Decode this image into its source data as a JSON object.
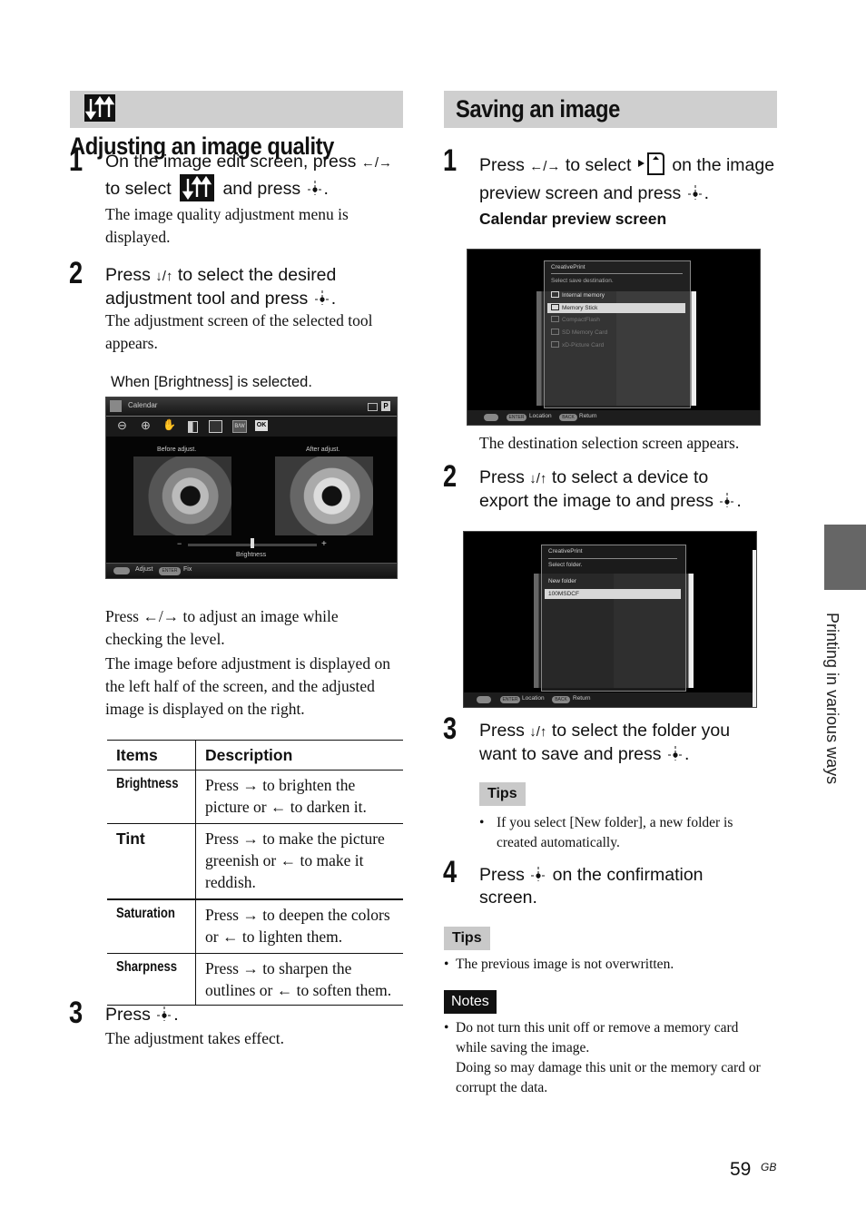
{
  "page": {
    "side_tab_label": "Printing in various ways",
    "page_number": "59",
    "page_suffix": "GB"
  },
  "left": {
    "header": {
      "icon": "image-quality-icon",
      "title": "Adjusting an image quality"
    },
    "steps": [
      {
        "num": "1",
        "instr_a": "On the image edit screen, press ",
        "instr_arrows": "←/→",
        "instr_b": "to select ",
        "instr_c": " and press ",
        "instr_end": ".",
        "desc": "The image quality adjustment menu is displayed."
      },
      {
        "num": "2",
        "instr_a": "Press ",
        "instr_arrows": "↓/↑",
        "instr_b": " to select the desired",
        "instr_c": "adjustment tool and press ",
        "instr_end": ".",
        "desc": "The adjustment screen of the selected tool appears.",
        "caption": "When [Brightness] is selected."
      },
      {
        "num": "3",
        "instr_a": "Press ",
        "instr_end": ".",
        "desc": "The adjustment takes effect."
      }
    ],
    "screen": {
      "title": "Calendar",
      "toolbar": [
        "zoom-out-icon",
        "zoom-in-icon",
        "hand-icon",
        "rotate-icon",
        "quality-icon",
        "bw-icon",
        "ok-icon"
      ],
      "bw_label": "B/W",
      "ok_label": "OK",
      "before_label": "Before adjust.",
      "after_label": "After adjust.",
      "slider_label": "Brightness",
      "slider_minus": "−",
      "slider_plus": "+",
      "slider_value_fraction": 0.5,
      "footer_adjust": "Adjust",
      "footer_enter": "ENTER",
      "footer_fix": "Fix"
    },
    "after_screen_p1": "Press ←/→ to adjust an image while checking the level.",
    "after_screen_p2": "The image before adjustment is displayed on the left half of the screen, and the adjusted image is displayed on the right.",
    "table": {
      "headers": [
        "Items",
        "Description"
      ],
      "rows": [
        {
          "item": "Brightness",
          "desc": "Press → to brighten the picture or ← to darken it."
        },
        {
          "item": "Tint",
          "desc": "Press → to make the picture greenish or ← to make it reddish."
        },
        {
          "item": "Saturation",
          "desc": "Press → to deepen the colors or ← to lighten them."
        },
        {
          "item": "Sharpness",
          "desc": "Press → to sharpen the outlines or ← to soften them."
        }
      ]
    }
  },
  "right": {
    "header": {
      "title": "Saving an image"
    },
    "steps": [
      {
        "num": "1",
        "instr_a": "Press ",
        "instr_arrows": "←/→",
        "instr_b": " to select ",
        "instr_c": " on the image",
        "instr_d": "preview screen and press ",
        "instr_end": ".",
        "subheading": "Calendar preview screen",
        "desc": "The destination selection screen appears."
      },
      {
        "num": "2",
        "instr_a": "Press ",
        "instr_arrows": "↓/↑",
        "instr_b": " to select a device to",
        "instr_c": "export the image to and press ",
        "instr_end": "."
      },
      {
        "num": "3",
        "instr_a": "Press ",
        "instr_arrows": "↓/↑",
        "instr_b": " to select the folder you",
        "instr_c": "want to save and press ",
        "instr_end": ".",
        "tips_label": "Tips",
        "tip": "If you select [New folder], a new folder is created automatically."
      },
      {
        "num": "4",
        "instr_a": "Press ",
        "instr_b": " on the confirmation",
        "instr_c": "screen."
      }
    ],
    "screen1": {
      "dialog_title": "CreativePrint",
      "prompt": "Select save destination.",
      "options": [
        {
          "label": "Internal memory",
          "state": "normal"
        },
        {
          "label": "Memory Stick",
          "state": "selected"
        },
        {
          "label": "CompactFlash",
          "state": "disabled"
        },
        {
          "label": "SD Memory Card",
          "state": "disabled"
        },
        {
          "label": "xD-Picture Card",
          "state": "disabled"
        }
      ],
      "footer_enter": "ENTER",
      "footer_location": "Location",
      "footer_back": "BACK",
      "footer_return": "Return"
    },
    "screen2": {
      "dialog_title": "CreativePrint",
      "prompt": "Select folder.",
      "options": [
        {
          "label": "New folder",
          "state": "normal"
        },
        {
          "label": "100MSDCF",
          "state": "selected"
        }
      ],
      "footer_enter": "ENTER",
      "footer_location": "Location",
      "footer_back": "BACK",
      "footer_return": "Return"
    },
    "tips_label": "Tips",
    "tip": "The previous image is not overwritten.",
    "notes_label": "Notes",
    "note_line1": "Do not turn this unit off or remove a memory card while saving the image.",
    "note_line2": "Doing so may damage this unit or the memory card or corrupt the data."
  }
}
